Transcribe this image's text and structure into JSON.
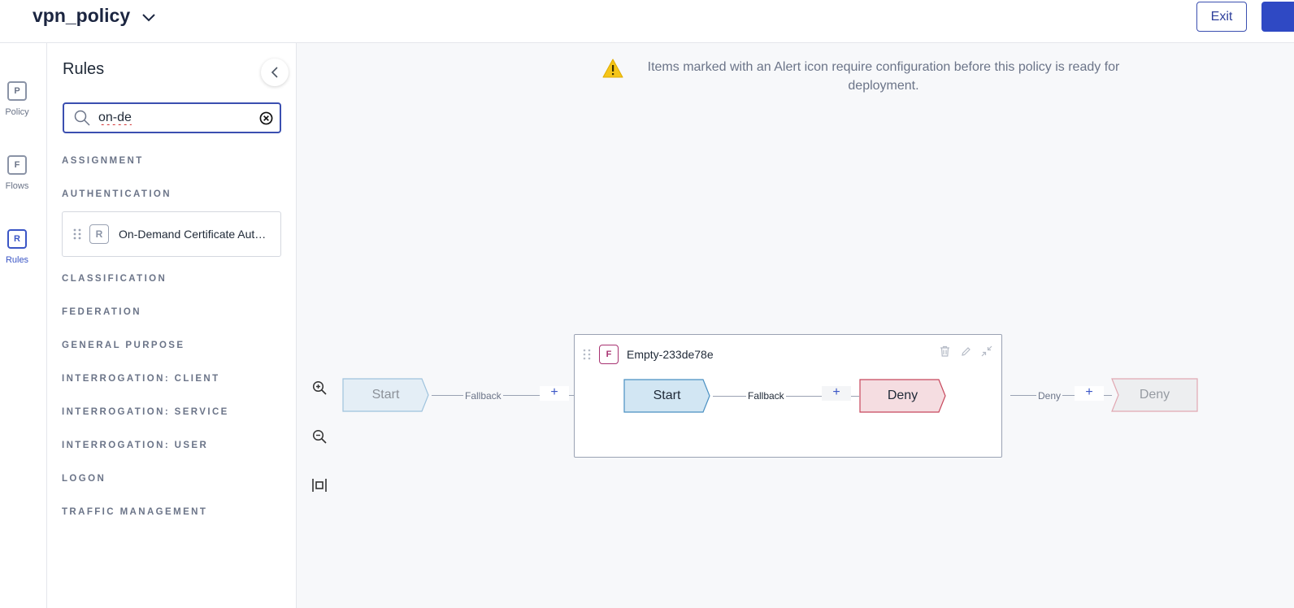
{
  "header": {
    "policy_name": "vpn_policy",
    "exit_label": "Exit"
  },
  "rail": {
    "items": [
      {
        "letter": "P",
        "label": "Policy"
      },
      {
        "letter": "F",
        "label": "Flows"
      },
      {
        "letter": "R",
        "label": "Rules"
      }
    ]
  },
  "panel": {
    "title": "Rules",
    "search": {
      "value": "on-de"
    },
    "categories": {
      "assignment": "ASSIGNMENT",
      "authentication": "AUTHENTICATION",
      "classification": "CLASSIFICATION",
      "federation": "FEDERATION",
      "general_purpose": "GENERAL PURPOSE",
      "interrogation_client": "INTERROGATION: CLIENT",
      "interrogation_service": "INTERROGATION: SERVICE",
      "interrogation_user": "INTERROGATION: USER",
      "logon": "LOGON",
      "traffic_management": "TRAFFIC MANAGEMENT"
    },
    "rule_result": {
      "badge": "R",
      "name": "On-Demand Certificate Authentication"
    }
  },
  "canvas": {
    "alert_text": "Items marked with an Alert icon require configuration before this policy is ready for deployment.",
    "outer": {
      "start_label": "Start",
      "fallback_label": "Fallback",
      "deny_edge_label": "Deny",
      "deny_node_label": "Deny"
    },
    "flow": {
      "badge": "F",
      "name": "Empty-233de78e",
      "start_label": "Start",
      "fallback_label": "Fallback",
      "deny_label": "Deny"
    },
    "plus": "+"
  },
  "colors": {
    "accent": "#3b56c6",
    "start_fill": "#d2e6f3",
    "start_stroke": "#4a90c2",
    "deny_fill": "#f5dde1",
    "deny_stroke": "#c7475c",
    "flow_badge": "#a83271",
    "alert_yellow": "#f5c518"
  }
}
